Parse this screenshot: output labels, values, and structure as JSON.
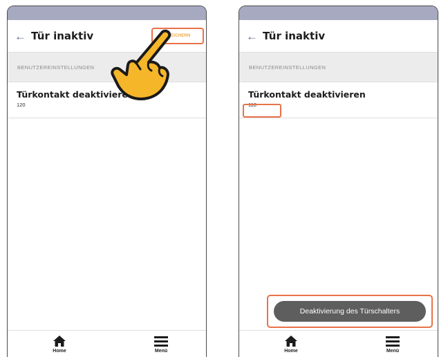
{
  "screens": {
    "left": {
      "header": {
        "back_icon": "arrow-left-icon",
        "title": "Tür inaktiv",
        "save_label": "SPEICHERN"
      },
      "section_header": "BENUTZEREINSTELLUNGEN",
      "setting": {
        "title": "Türkontakt deaktivieren",
        "value": "120"
      },
      "nav": {
        "home_label": "Home",
        "menu_label": "Menü"
      }
    },
    "right": {
      "header": {
        "back_icon": "arrow-left-icon",
        "title": "Tür inaktiv"
      },
      "section_header": "BENUTZEREINSTELLUNGEN",
      "setting": {
        "title": "Türkontakt deaktivieren",
        "value": "118"
      },
      "toast": "Deaktivierung des Türschalters",
      "nav": {
        "home_label": "Home",
        "menu_label": "Menü"
      }
    }
  },
  "colors": {
    "status_bar": "#a6a9c0",
    "highlight": "#e8724a",
    "save_text": "#f1a93a",
    "hand_fill": "#f6b62a",
    "toast_bg": "#5e5e5e"
  }
}
